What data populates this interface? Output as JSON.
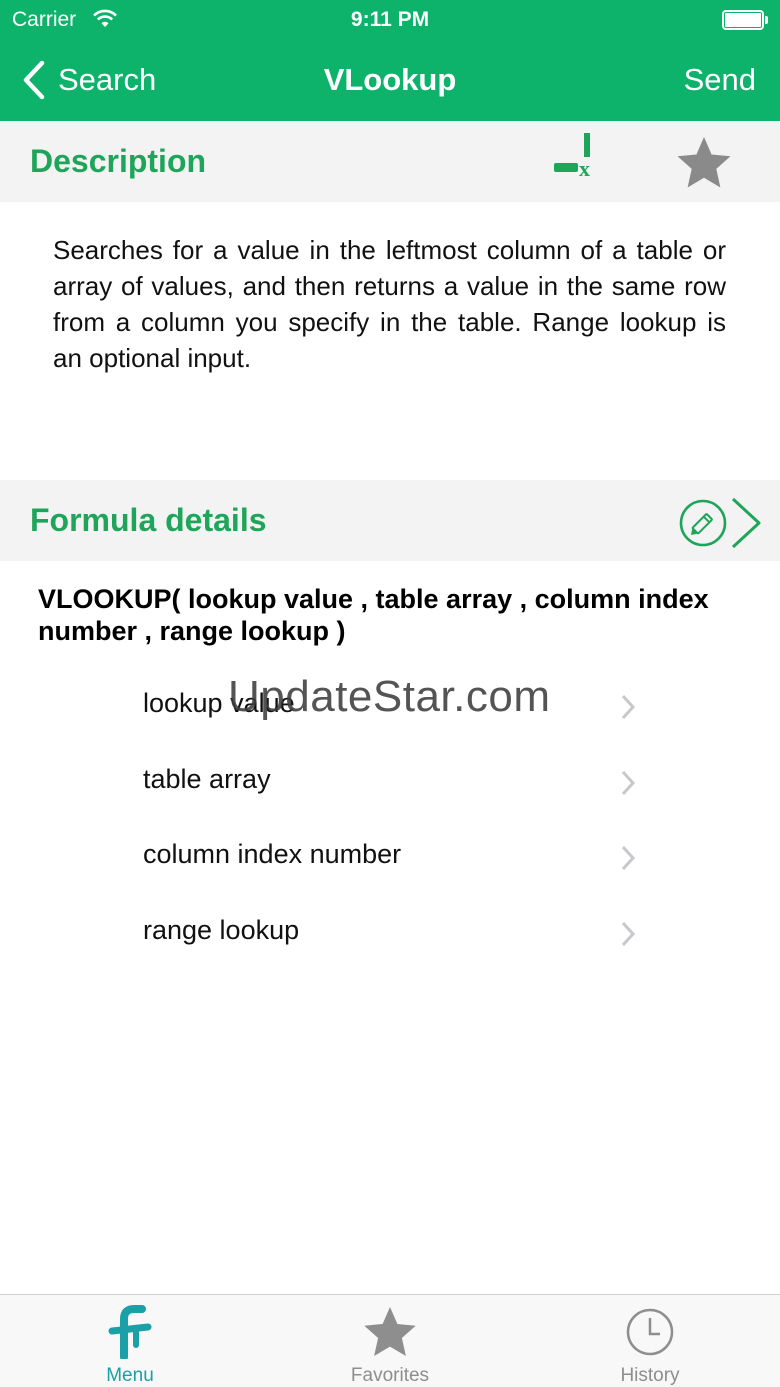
{
  "status_bar": {
    "carrier": "Carrier",
    "time": "9:11 PM"
  },
  "nav": {
    "back_label": "Search",
    "title": "VLookup",
    "send_label": "Send"
  },
  "description_section": {
    "title": "Description",
    "text": "Searches for a value in the leftmost column of a table or array of values, and then returns a value in the same row from a column you specify in the table. Range lookup is an optional input."
  },
  "formula_section": {
    "title": "Formula details",
    "formula": "VLOOKUP( lookup value , table array , column index number , range lookup )",
    "parameters": [
      {
        "label": "lookup value"
      },
      {
        "label": "table array"
      },
      {
        "label": "column index number"
      },
      {
        "label": "range lookup"
      }
    ]
  },
  "watermark": "UpdateStar.com",
  "tab_bar": {
    "tabs": [
      {
        "label": "Menu",
        "icon": "menu-f-icon",
        "active": true
      },
      {
        "label": "Favorites",
        "icon": "star-icon",
        "active": false
      },
      {
        "label": "History",
        "icon": "clock-icon",
        "active": false
      }
    ]
  },
  "colors": {
    "header": "#0db36b",
    "section_title": "#1fa55a",
    "active_tab": "#1aa0a6",
    "inactive_tab": "#8e8e8e"
  }
}
